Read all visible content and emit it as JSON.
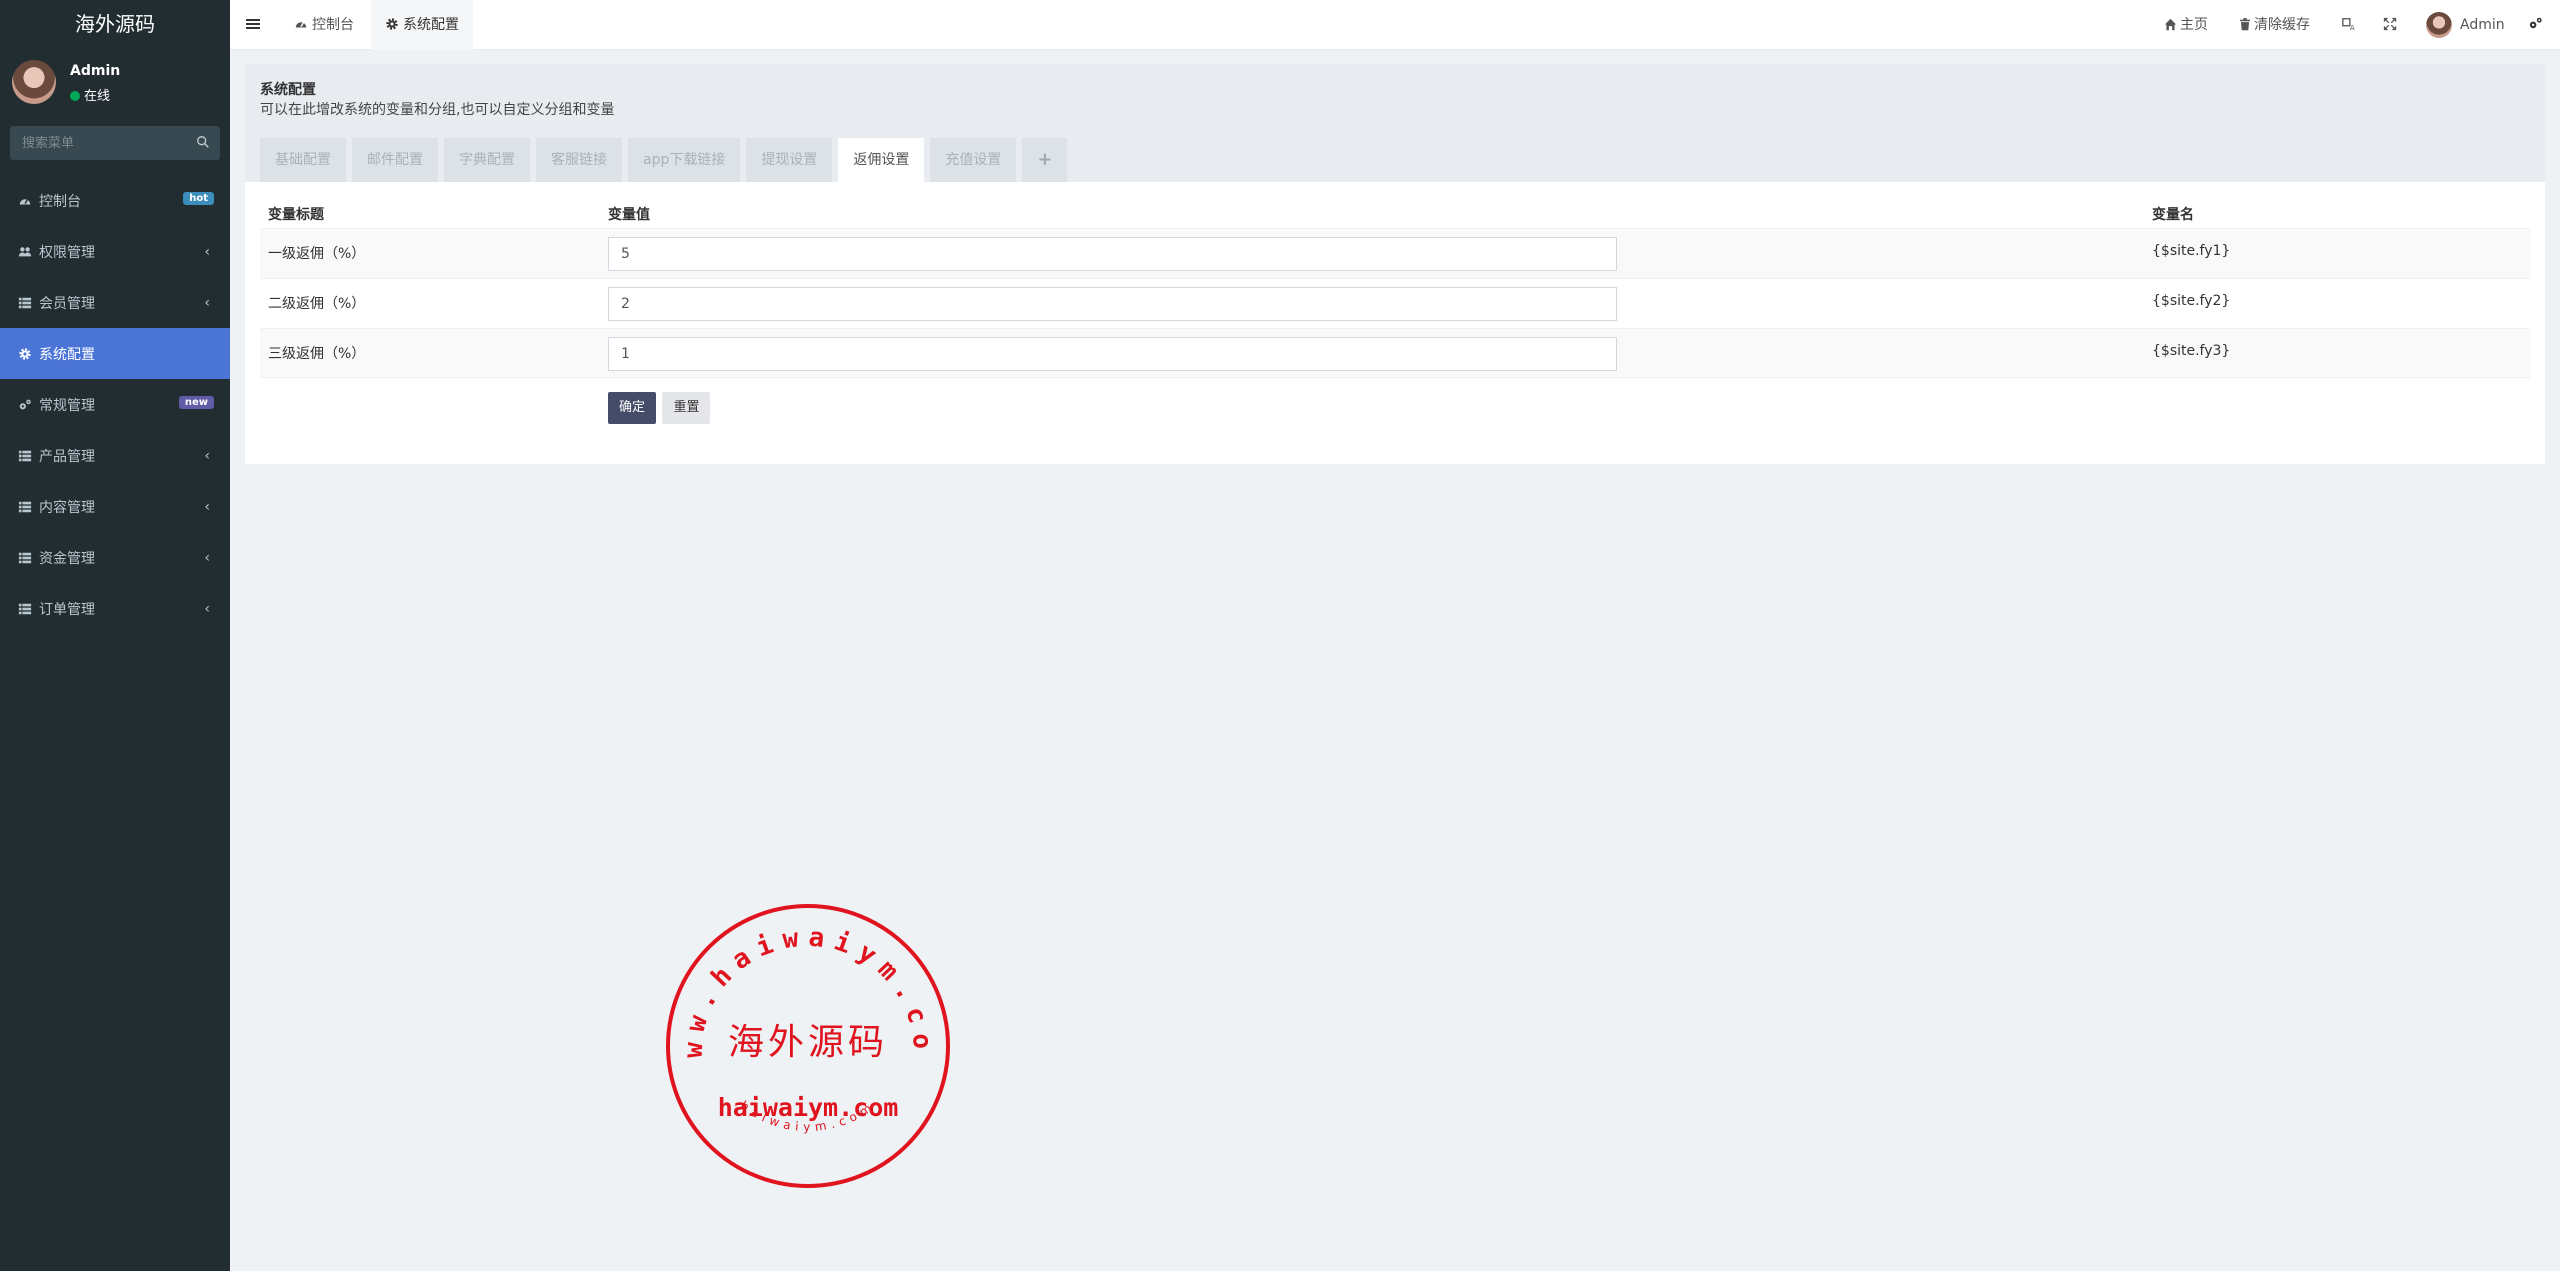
{
  "app": {
    "logo_text": "海外源码"
  },
  "user": {
    "name": "Admin",
    "status": "在线",
    "status_color": "#00a65a"
  },
  "search": {
    "placeholder": "搜索菜单"
  },
  "sidebar": {
    "items": [
      {
        "label": "控制台",
        "icon": "dashboard-icon",
        "badge": "hot"
      },
      {
        "label": "权限管理",
        "icon": "users-icon",
        "has_arrow": true
      },
      {
        "label": "会员管理",
        "icon": "list-icon",
        "has_arrow": true
      },
      {
        "label": "系统配置",
        "icon": "gear-icon",
        "active": true
      },
      {
        "label": "常规管理",
        "icon": "cogs-icon",
        "badge": "new"
      },
      {
        "label": "产品管理",
        "icon": "list-icon",
        "has_arrow": true
      },
      {
        "label": "内容管理",
        "icon": "list-icon",
        "has_arrow": true
      },
      {
        "label": "资金管理",
        "icon": "list-icon",
        "has_arrow": true
      },
      {
        "label": "订单管理",
        "icon": "list-icon",
        "has_arrow": true
      }
    ]
  },
  "topbar": {
    "tabs": [
      {
        "label": "控制台",
        "icon": "dashboard-icon"
      },
      {
        "label": "系统配置",
        "icon": "gear-icon",
        "active": true
      }
    ],
    "home_label": "主页",
    "clear_cache_label": "清除缓存",
    "user_label": "Admin"
  },
  "page": {
    "title": "系统配置",
    "description": "可以在此增改系统的变量和分组,也可以自定义分组和变量",
    "tabs": [
      "基础配置",
      "邮件配置",
      "字典配置",
      "客服链接",
      "app下载链接",
      "提现设置",
      "返佣设置",
      "充值设置"
    ],
    "active_tab": "返佣设置",
    "add_tab_symbol": "+"
  },
  "table": {
    "headers": {
      "title": "变量标题",
      "value": "变量值",
      "name": "变量名"
    },
    "rows": [
      {
        "title": "一级返佣（%）",
        "value": "5",
        "name": "{$site.fy1}"
      },
      {
        "title": "二级返佣（%）",
        "value": "2",
        "name": "{$site.fy2}"
      },
      {
        "title": "三级返佣（%）",
        "value": "1",
        "name": "{$site.fy3}"
      }
    ]
  },
  "buttons": {
    "confirm": "确定",
    "reset": "重置"
  },
  "watermark": {
    "ring_text": "www.haiwaiym.com",
    "center_text": "海外源码",
    "domain_text": "haiwaiym.com",
    "bottom_text": "haiwaiym.com",
    "color": "#e0141e"
  },
  "colors": {
    "sidebar_bg": "#222d32",
    "active_menu": "#4a74d6",
    "primary_button": "#444c69"
  }
}
